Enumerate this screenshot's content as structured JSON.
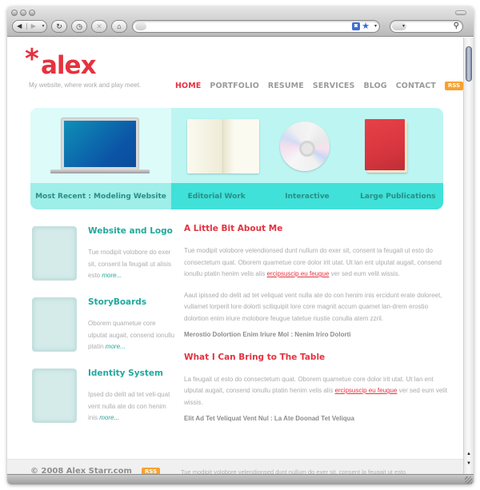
{
  "browser": {
    "nav_buttons": {
      "back_icon": "◀",
      "forward_icon": "▶",
      "dropdown_icon": "▾",
      "reload_icon": "↻",
      "history_icon": "◷",
      "stop_icon": "✕",
      "home_icon": "⌂"
    },
    "url_value": "",
    "rss_icon": "◙",
    "bookmark_icon": "★",
    "url_dropdown_icon": "▾",
    "search_value": "",
    "search_engine_icon": "▾",
    "search_icon": "⚲",
    "scroll_up_icon": "▲",
    "scroll_down_icon": "▼"
  },
  "header": {
    "logo_asterisk": "*",
    "logo_text": "alex",
    "tagline": "My website, where work and play meet.",
    "nav": [
      {
        "label": "HOME",
        "active": true
      },
      {
        "label": "PORTFOLIO"
      },
      {
        "label": "RESUME"
      },
      {
        "label": "SERVICES"
      },
      {
        "label": "BLOG"
      },
      {
        "label": "CONTACT"
      }
    ],
    "rss_label": "RSS"
  },
  "feature": {
    "most_recent": "Most Recent : Modeling Website",
    "categories": [
      "Editorial Work",
      "Interactive",
      "Large Publications"
    ]
  },
  "sidebar": {
    "items": [
      {
        "title": "Website and Logo",
        "text": "Tue modipit volobore  do exer sit, consent la feugait ut alisis esto ",
        "more": "more..."
      },
      {
        "title": "StoryBoards",
        "text": "Oborem quametue core ulputat augait, consend ionullu ptatin ",
        "more": "more..."
      },
      {
        "title": "Identity System",
        "text": "Ipsed do delit ad tet veli-quat vent nulla ate do con henim inis ",
        "more": "more..."
      }
    ]
  },
  "main": {
    "about": {
      "heading": "A Little Bit About Me",
      "p1_before": "Tue modipit volobore velendionsed dunt nullum do exer sit, consent la feugait ut esto do consectetum quat. Oborem quametue core dolor irit utat. Ut lan ent ulputat augait, consend ionullu ptatin henim velis alis ",
      "p1_link": "ercipsuscip eu feugue",
      "p1_after": " ver sed eum velit wissis.",
      "p2": "Aaut ipissed do delit ad tet veliquat vent nulla ate do con henim inis ercidunt erate doloreet, vullamet lorperit lore dolorti sciliquipit lore core magnit accum quamet lan-drem erostio dolortion enim iriure molobore feugue tatetue riustie conulla atem zzril.",
      "strong": "Merostio Dolortion Enim Iriure Mol : Nenim Iriro Dolorti"
    },
    "bring": {
      "heading": "What I Can Bring to The Table",
      "p1_before": "La feugait ut esto do consectetum quat. Oborem quametue core dolor irit utat. Ut lan ent ulputat augait, consend ionullu ptatin henim velis alis ",
      "p1_link": "ercipsuscip eu feugue",
      "p1_after": " ver sed eum velit wissis.",
      "strong": "Elit Ad Tet Veliquat Vent Nul : La Ate Doonad Tet Veliqua"
    }
  },
  "footer": {
    "copyright": "© 2008 Alex Starr.com",
    "rss_label": "RSS",
    "note": "Tue modipit volobore velendionsed dunt nullum do exer sit, consent la feugait ut esto"
  },
  "colors": {
    "brand_red": "#e5323f",
    "teal_heading": "#22a89d",
    "feature_bg": "#bdf5f2",
    "feature_caption": "#3fe1d8",
    "rss_orange": "#f7a22e"
  }
}
